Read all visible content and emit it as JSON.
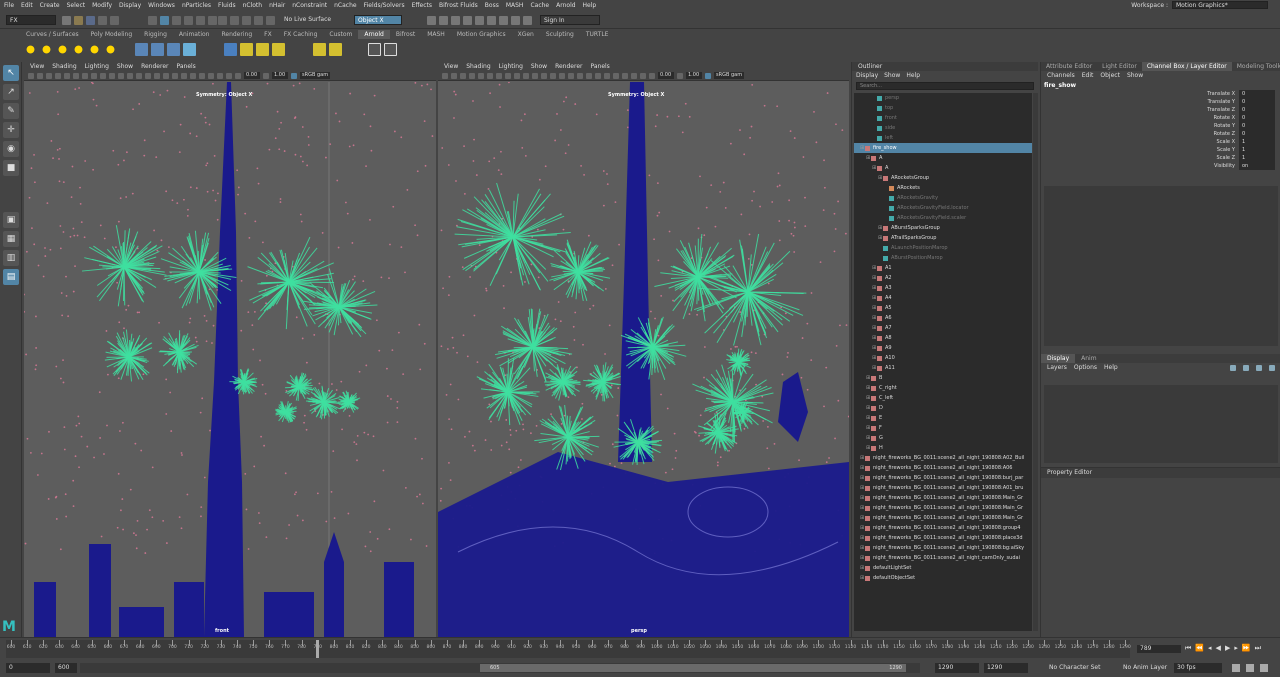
{
  "menubar": [
    "File",
    "Edit",
    "Create",
    "Select",
    "Modify",
    "Display",
    "Windows",
    "nParticles",
    "Fluids",
    "nCloth",
    "nHair",
    "nConstraint",
    "nCache",
    "Fields/Solvers",
    "Effects",
    "Bifrost Fluids",
    "Boss",
    "MASH",
    "Cache",
    "Arnold",
    "Help"
  ],
  "workspace": {
    "label": "Workspace :",
    "value": "Motion Graphics*"
  },
  "status": {
    "menuset": "FX",
    "live_surface": "No Live Surface",
    "symmetry": "Object X",
    "sign_in": "Sign In"
  },
  "shelf_tabs": [
    "Curves / Surfaces",
    "Poly Modeling",
    "Rigging",
    "Animation",
    "Rendering",
    "FX",
    "FX Caching",
    "Custom",
    "Arnold",
    "Bifrost",
    "MASH",
    "Motion Graphics",
    "XGen",
    "Sculpting",
    "TURTLE"
  ],
  "shelf_active": "Arnold",
  "viewport_menu": [
    "View",
    "Shading",
    "Lighting",
    "Show",
    "Renderer",
    "Panels"
  ],
  "viewport_fields": {
    "exposure": "0.00",
    "gamma": "1.00",
    "colorspace": "sRGB gam"
  },
  "viewports": [
    {
      "symmetry_label": "Symmetry: Object X",
      "camera": "front"
    },
    {
      "symmetry_label": "Symmetry: Object X",
      "camera": "persp"
    }
  ],
  "outliner": {
    "title": "Outliner",
    "menu": [
      "Display",
      "Show",
      "Help"
    ],
    "search_placeholder": "Search...",
    "items": [
      {
        "label": "persp",
        "indent": 2,
        "dim": true
      },
      {
        "label": "top",
        "indent": 2,
        "dim": true
      },
      {
        "label": "front",
        "indent": 2,
        "dim": true
      },
      {
        "label": "side",
        "indent": 2,
        "dim": true
      },
      {
        "label": "left",
        "indent": 2,
        "dim": true
      },
      {
        "label": "fire_show",
        "indent": 0,
        "selected": true
      },
      {
        "label": "A",
        "indent": 1
      },
      {
        "label": "A",
        "indent": 2
      },
      {
        "label": "ARocketsGroup",
        "indent": 3
      },
      {
        "label": "ARockets",
        "indent": 4
      },
      {
        "label": "ARocketsGravity",
        "indent": 4,
        "dim": true
      },
      {
        "label": "ARocketsGravityField.locator",
        "indent": 4,
        "dim": true
      },
      {
        "label": "ARocketsGravityField.scaler",
        "indent": 4,
        "dim": true
      },
      {
        "label": "ABurstSparksGroup",
        "indent": 3
      },
      {
        "label": "ATrailSparksGroup",
        "indent": 3
      },
      {
        "label": "ALaunchPositionMarop",
        "indent": 3,
        "dim": true
      },
      {
        "label": "ABurstPositionMarop",
        "indent": 3,
        "dim": true
      },
      {
        "label": "A1",
        "indent": 2
      },
      {
        "label": "A2",
        "indent": 2
      },
      {
        "label": "A3",
        "indent": 2
      },
      {
        "label": "A4",
        "indent": 2
      },
      {
        "label": "A5",
        "indent": 2
      },
      {
        "label": "A6",
        "indent": 2
      },
      {
        "label": "A7",
        "indent": 2
      },
      {
        "label": "A8",
        "indent": 2
      },
      {
        "label": "A9",
        "indent": 2
      },
      {
        "label": "A10",
        "indent": 2
      },
      {
        "label": "A11",
        "indent": 2
      },
      {
        "label": "B",
        "indent": 1
      },
      {
        "label": "C_right",
        "indent": 1
      },
      {
        "label": "C_left",
        "indent": 1
      },
      {
        "label": "D",
        "indent": 1
      },
      {
        "label": "E",
        "indent": 1
      },
      {
        "label": "F",
        "indent": 1
      },
      {
        "label": "G",
        "indent": 1
      },
      {
        "label": "H",
        "indent": 1
      },
      {
        "label": "night_fireworks_BG_0011:scene2_all_night_190808:A02_Buil",
        "indent": 0
      },
      {
        "label": "night_fireworks_BG_0011:scene2_all_night_190808:A06",
        "indent": 0
      },
      {
        "label": "night_fireworks_BG_0011:scene2_all_night_190808:burj_par",
        "indent": 0
      },
      {
        "label": "night_fireworks_BG_0011:scene2_all_night_190808:A01_bru",
        "indent": 0
      },
      {
        "label": "night_fireworks_BG_0011:scene2_all_night_190808:Main_Gr",
        "indent": 0
      },
      {
        "label": "night_fireworks_BG_0011:scene2_all_night_190808:Main_Gr",
        "indent": 0
      },
      {
        "label": "night_fireworks_BG_0011:scene2_all_night_190808:Main_Gr",
        "indent": 0
      },
      {
        "label": "night_fireworks_BG_0011:scene2_all_night_190808:group4",
        "indent": 0
      },
      {
        "label": "night_fireworks_BG_0011:scene2_all_night_190808:place3d",
        "indent": 0
      },
      {
        "label": "night_fireworks_BG_0011:scene2_all_night_190808:bg:aiSky",
        "indent": 0
      },
      {
        "label": "night_fireworks_BG_0011:scene2_all_night_camOnly_sudai",
        "indent": 0
      },
      {
        "label": "defaultLightSet",
        "indent": 0
      },
      {
        "label": "defaultObjectSet",
        "indent": 0
      }
    ]
  },
  "right_tabs": [
    "Attribute Editor",
    "Light Editor",
    "Channel Box / Layer Editor",
    "Modeling Toolkit"
  ],
  "right_active": "Channel Box / Layer Editor",
  "channel_menu": [
    "Channels",
    "Edit",
    "Object",
    "Show"
  ],
  "channel_object": "fire_show",
  "channels": [
    {
      "name": "Translate X",
      "value": "0"
    },
    {
      "name": "Translate Y",
      "value": "0"
    },
    {
      "name": "Translate Z",
      "value": "0"
    },
    {
      "name": "Rotate X",
      "value": "0"
    },
    {
      "name": "Rotate Y",
      "value": "0"
    },
    {
      "name": "Rotate Z",
      "value": "0"
    },
    {
      "name": "Scale X",
      "value": "1"
    },
    {
      "name": "Scale Y",
      "value": "1"
    },
    {
      "name": "Scale Z",
      "value": "1"
    },
    {
      "name": "Visibility",
      "value": "on"
    }
  ],
  "layer_tabs": [
    "Display",
    "Anim"
  ],
  "layer_menu": [
    "Layers",
    "Options",
    "Help"
  ],
  "property_editor": "Property Editor",
  "timeline": {
    "ticks": [
      600,
      610,
      620,
      630,
      640,
      650,
      660,
      670,
      680,
      690,
      700,
      710,
      720,
      730,
      740,
      750,
      760,
      770,
      780,
      790,
      800,
      810,
      820,
      830,
      840,
      850,
      860,
      870,
      880,
      890,
      900,
      910,
      920,
      930,
      940,
      950,
      960,
      970,
      980,
      990,
      1000,
      1010,
      1020,
      1030,
      1040,
      1050,
      1060,
      1070,
      1080,
      1090,
      1100,
      1110,
      1120,
      1130,
      1140,
      1150,
      1160,
      1170,
      1180,
      1190,
      1200,
      1210,
      1220,
      1230,
      1240,
      1250,
      1260,
      1270,
      1280,
      1290
    ],
    "current_frame": "789",
    "current_frame_tick": 789,
    "start": 600,
    "end": 1290
  },
  "range": {
    "min": "0",
    "start": "600",
    "slider_start": "605",
    "slider_end": "1290",
    "end": "1290",
    "max": "1290",
    "character_set": "No Character Set",
    "anim_layer": "No Anim Layer",
    "fps": "30 fps"
  },
  "colors": {
    "accent": "#5285a6",
    "firework": "#3fe0a0",
    "building": "#1a1a8c",
    "particles": "#e07a9a"
  }
}
